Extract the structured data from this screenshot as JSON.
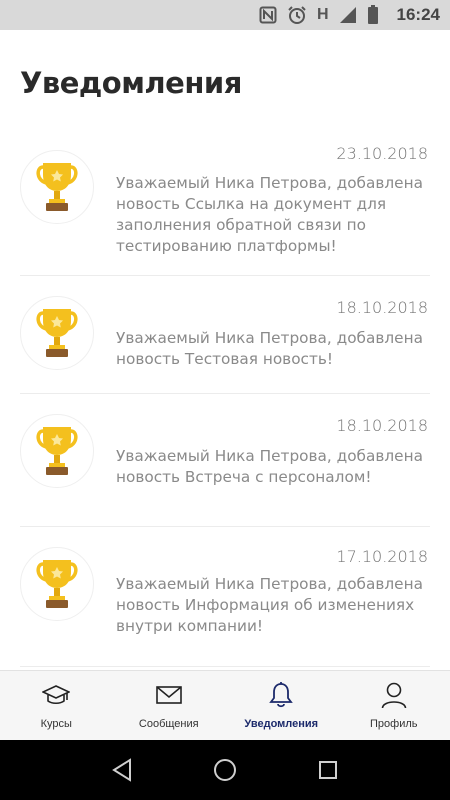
{
  "status_bar": {
    "time": "16:24",
    "network_type": "H",
    "icons": [
      "nfc-icon",
      "alarm-icon",
      "signal-icon",
      "battery-icon"
    ]
  },
  "page": {
    "title": "Уведомления"
  },
  "notifications": [
    {
      "date": "23.10.2018",
      "text": "Уважаемый Ника Петрова, добавлена новость Ссылка на документ для заполнения обратной связи по тестированию платформы!",
      "icon": "trophy-icon"
    },
    {
      "date": "18.10.2018",
      "text": "Уважаемый Ника Петрова, добавлена новость Тестовая новость!",
      "icon": "trophy-icon"
    },
    {
      "date": "18.10.2018",
      "text": "Уважаемый Ника Петрова, добавлена новость Встреча с персоналом!",
      "icon": "trophy-icon"
    },
    {
      "date": "17.10.2018",
      "text": "Уважаемый Ника Петрова, добавлена новость Информация об изменениях внутри компании!",
      "icon": "trophy-icon"
    }
  ],
  "tabs": [
    {
      "label": "Курсы",
      "icon": "graduation-cap-icon",
      "active": false
    },
    {
      "label": "Сообщения",
      "icon": "envelope-icon",
      "active": false
    },
    {
      "label": "Уведомления",
      "icon": "bell-icon",
      "active": true
    },
    {
      "label": "Профиль",
      "icon": "user-icon",
      "active": false
    }
  ],
  "colors": {
    "accent": "#1c2a6b",
    "trophy_gold": "#f4c01e",
    "trophy_base": "#8a5a2b",
    "text_muted": "#8a8a8a",
    "title": "#2a2a2a"
  }
}
